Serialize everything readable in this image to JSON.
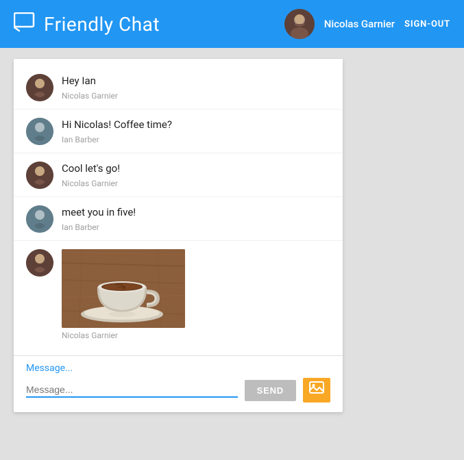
{
  "header": {
    "title": "Friendly Chat",
    "icon_label": "chat-bubble-icon",
    "user": {
      "name": "Nicolas Garnier",
      "signout_label": "SIGN-OUT"
    }
  },
  "messages": [
    {
      "id": 1,
      "text": "Hey Ian",
      "sender": "Nicolas Garnier",
      "avatar_type": "nicolas"
    },
    {
      "id": 2,
      "text": "Hi Nicolas! Coffee time?",
      "sender": "Ian Barber",
      "avatar_type": "ian"
    },
    {
      "id": 3,
      "text": "Cool let's go!",
      "sender": "Nicolas Garnier",
      "avatar_type": "nicolas"
    },
    {
      "id": 4,
      "text": "meet you in five!",
      "sender": "Ian Barber",
      "avatar_type": "ian"
    },
    {
      "id": 5,
      "text": "",
      "sender": "Nicolas Garnier",
      "avatar_type": "nicolas",
      "has_image": true
    }
  ],
  "input": {
    "placeholder": "Message...",
    "send_label": "SEND",
    "current_value": ""
  }
}
